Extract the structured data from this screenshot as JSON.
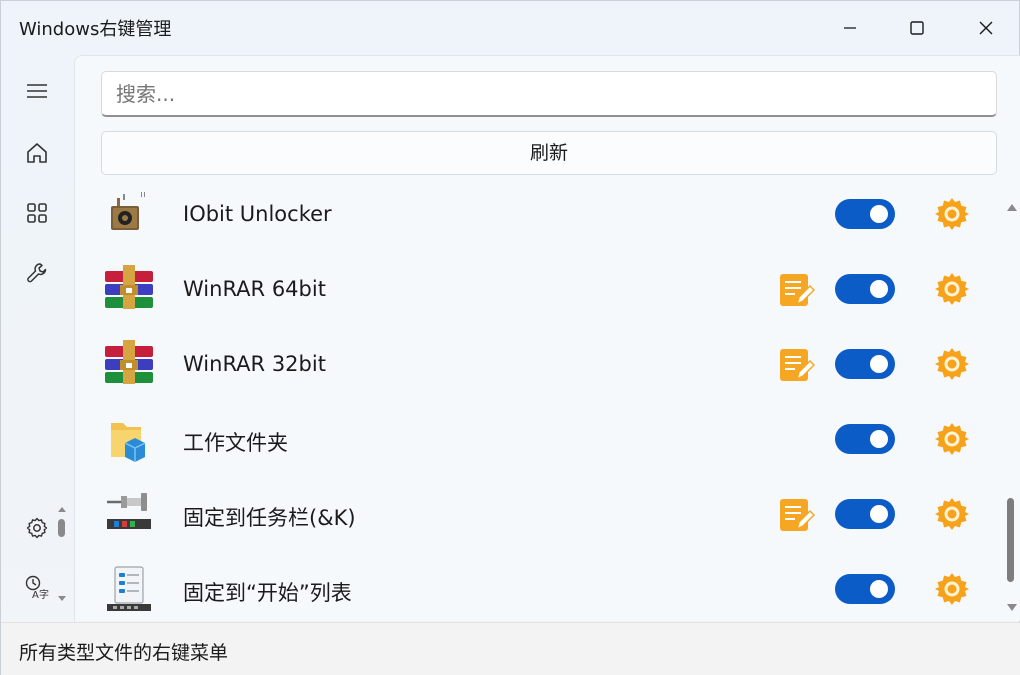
{
  "window": {
    "title": "Windows右键管理",
    "controls": [
      "minimize-icon",
      "maximize-icon",
      "close-icon"
    ]
  },
  "nav": {
    "items": [
      {
        "icon": "hamburger-menu-icon"
      },
      {
        "icon": "home-icon"
      },
      {
        "icon": "apps-grid-icon"
      },
      {
        "icon": "wrench-icon"
      }
    ],
    "footer_items": [
      {
        "icon": "settings-gear-icon"
      },
      {
        "icon": "language-icon"
      }
    ]
  },
  "search": {
    "placeholder": "搜索..."
  },
  "refresh": {
    "label": "刷新"
  },
  "colors": {
    "accent": "#0b5cc7",
    "gear": "#f6a21a",
    "edit": "#f5a623"
  },
  "items": [
    {
      "name": "IObit Unlocker",
      "icon": "iobit-unlocker-icon",
      "has_edit": false,
      "enabled": true
    },
    {
      "name": "WinRAR 64bit",
      "icon": "winrar-icon",
      "has_edit": true,
      "enabled": true
    },
    {
      "name": "WinRAR 32bit",
      "icon": "winrar-icon",
      "has_edit": true,
      "enabled": true
    },
    {
      "name": "工作文件夹",
      "icon": "work-folders-icon",
      "has_edit": false,
      "enabled": true
    },
    {
      "name": "固定到任务栏(&K)",
      "icon": "pin-taskbar-icon",
      "has_edit": true,
      "enabled": true
    },
    {
      "name": "固定到“开始”列表",
      "icon": "pin-start-icon",
      "has_edit": false,
      "enabled": true
    }
  ],
  "status": {
    "text": "所有类型文件的右键菜单"
  }
}
